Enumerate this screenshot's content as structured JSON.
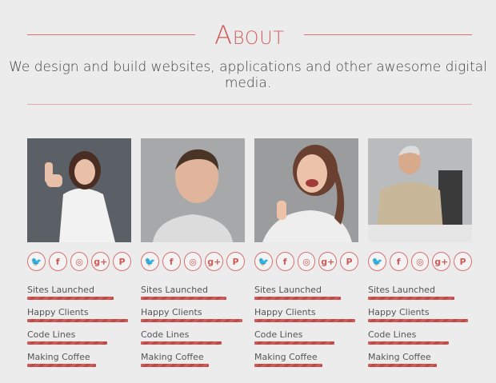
{
  "about": {
    "title": "About",
    "tagline": "We design and build websites, applications and other awesome digital media."
  },
  "social_icons": [
    {
      "name": "twitter-icon",
      "glyph": "🐦"
    },
    {
      "name": "facebook-icon",
      "glyph": "f"
    },
    {
      "name": "dribbble-icon",
      "glyph": "◎"
    },
    {
      "name": "google-plus-icon",
      "glyph": "g+"
    },
    {
      "name": "pinterest-icon",
      "glyph": "P"
    }
  ],
  "stat_labels": [
    "Sites Launched",
    "Happy Clients",
    "Code Lines",
    "Making Coffee"
  ],
  "members": [
    {
      "stats": [
        0.83,
        0.97,
        0.77,
        0.66
      ]
    },
    {
      "stats": [
        0.82,
        0.98,
        0.78,
        0.65
      ]
    },
    {
      "stats": [
        0.83,
        0.97,
        0.77,
        0.65
      ]
    },
    {
      "stats": [
        0.83,
        0.96,
        0.78,
        0.66
      ]
    }
  ],
  "colors": {
    "accent": "#d05a57",
    "background": "#ececec"
  }
}
